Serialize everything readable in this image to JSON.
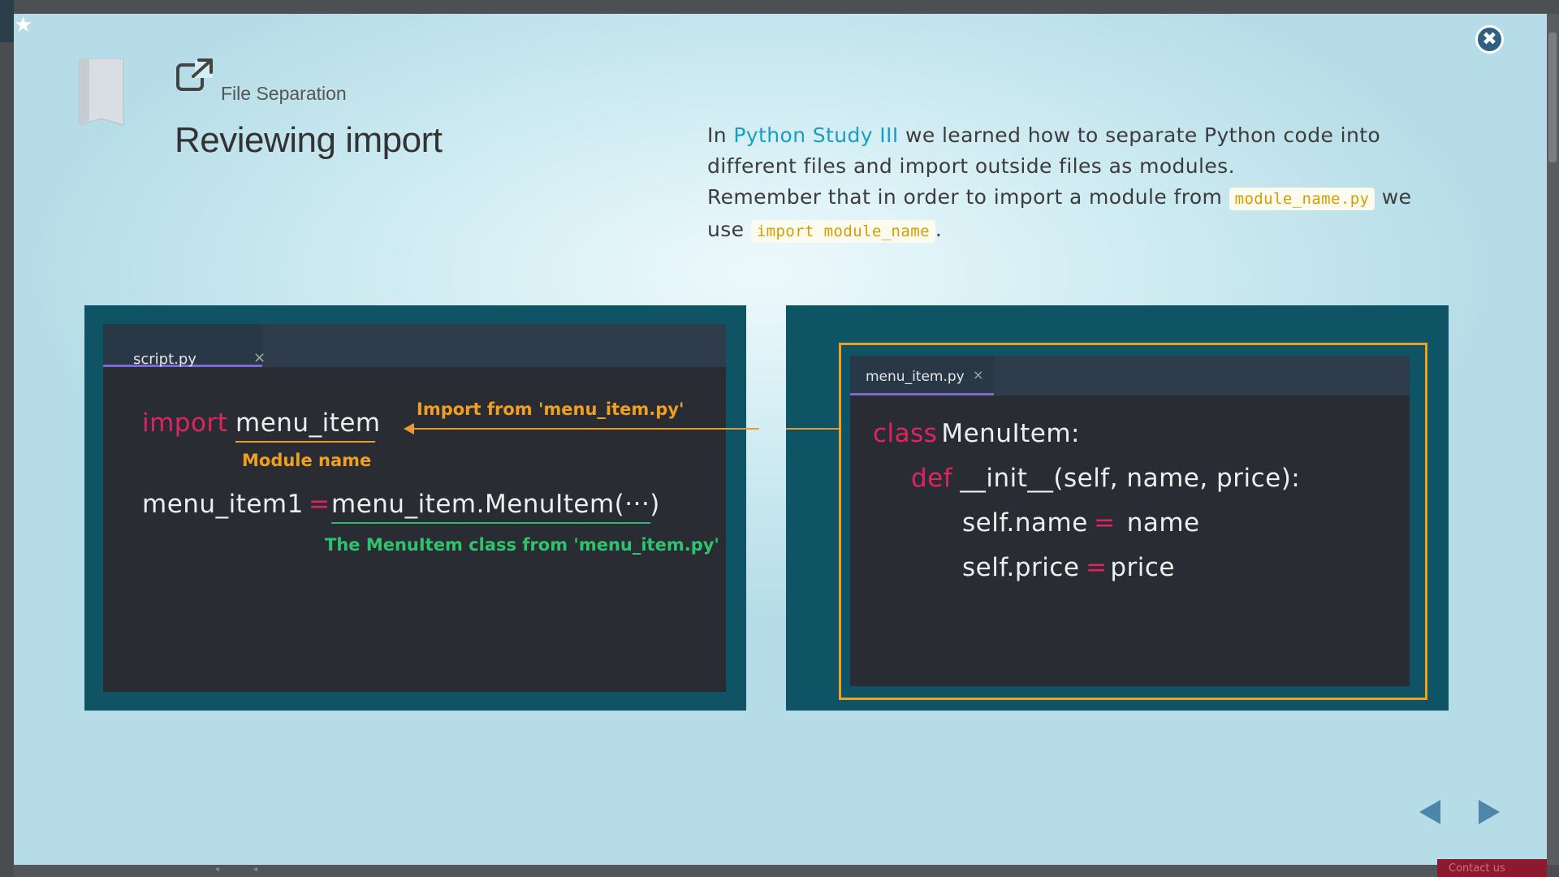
{
  "header": {
    "section_label": "File Separation",
    "title": "Reviewing import",
    "section_icon": "external-link-icon",
    "bookmark_icon": "star-icon"
  },
  "intro": {
    "prefix": "In ",
    "link": "Python Study III",
    "line1_rest": " we learned how to separate Python code into different files and import outside files as modules.",
    "line2_prefix": "Remember that in order to import a module from ",
    "code1": "module_name.py",
    "line2_mid": " we use ",
    "code2": "import module_name",
    "line2_end": "."
  },
  "left_editor": {
    "tab_label": "script.py",
    "tab_close": "×",
    "line1_keyword": "import",
    "line1_module": "menu_item",
    "line2_var": "menu_item1",
    "line2_eq": "=",
    "line2_call": "menu_item.MenuItem(···)",
    "annotation_import": "Import from 'menu_item.py'",
    "annotation_module": "Module name",
    "annotation_class": "The MenuItem class from 'menu_item.py'"
  },
  "right_editor": {
    "tab_label": "menu_item.py",
    "tab_close": "×",
    "line1_keyword": "class",
    "line1_rest": " MenuItem:",
    "line2_keyword": "def",
    "line2_rest": " __init__(self, name, price):",
    "line3_left": "self.name",
    "line3_eq": "=",
    "line3_right": "  name",
    "line4_left": "self.price",
    "line4_eq": "=",
    "line4_right": " price"
  },
  "footer": {
    "contact_label": "Contact us"
  },
  "colors": {
    "keyword": "#e0245e",
    "link": "#1a9dc4",
    "annotation_orange": "#f0a020",
    "annotation_green": "#2ec46e",
    "panel_bg": "#0f5465",
    "editor_bg": "#2a2c33"
  }
}
